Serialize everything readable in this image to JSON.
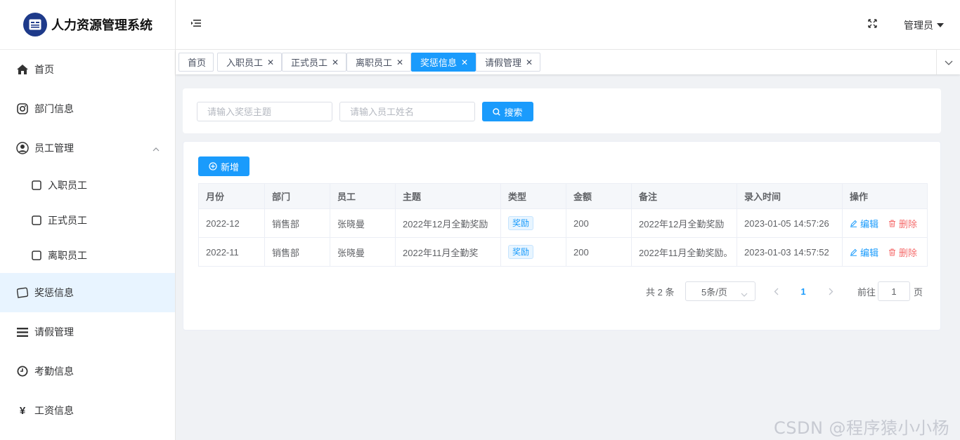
{
  "app": {
    "title": "人力资源管理系统"
  },
  "sidebar": {
    "items": [
      {
        "label": "首页",
        "icon": "home-icon"
      },
      {
        "label": "部门信息",
        "icon": "instagram-icon"
      },
      {
        "label": "员工管理",
        "icon": "user-icon",
        "expanded": true
      },
      {
        "label": "入职员工",
        "icon": "square-icon"
      },
      {
        "label": "正式员工",
        "icon": "square-icon"
      },
      {
        "label": "离职员工",
        "icon": "square-icon"
      },
      {
        "label": "奖惩信息",
        "icon": "chat-bubble-icon",
        "active": true
      },
      {
        "label": "请假管理",
        "icon": "list-icon"
      },
      {
        "label": "考勤信息",
        "icon": "clock-icon"
      },
      {
        "label": "工资信息",
        "icon": "yen-icon"
      }
    ]
  },
  "header": {
    "user": "管理员"
  },
  "tabs": [
    {
      "label": "首页",
      "closable": false
    },
    {
      "label": "入职员工",
      "closable": true
    },
    {
      "label": "正式员工",
      "closable": true
    },
    {
      "label": "离职员工",
      "closable": true
    },
    {
      "label": "奖惩信息",
      "closable": true,
      "active": true
    },
    {
      "label": "请假管理",
      "closable": true
    }
  ],
  "search": {
    "topic_placeholder": "请输入奖惩主题",
    "name_placeholder": "请输入员工姓名",
    "button": "搜索"
  },
  "toolbar": {
    "add_label": "新增"
  },
  "table": {
    "columns": [
      "月份",
      "部门",
      "员工",
      "主题",
      "类型",
      "金额",
      "备注",
      "录入时间",
      "操作"
    ],
    "rows": [
      {
        "month": "2022-12",
        "dept": "销售部",
        "employee": "张晓曼",
        "topic": "2022年12月全勤奖励",
        "type": "奖励",
        "amount": "200",
        "remark": "2022年12月全勤奖励",
        "time": "2023-01-05 14:57:26",
        "edit": "编辑",
        "delete": "删除"
      },
      {
        "month": "2022-11",
        "dept": "销售部",
        "employee": "张晓曼",
        "topic": "2022年11月全勤奖",
        "type": "奖励",
        "amount": "200",
        "remark": "2022年11月全勤奖励。",
        "time": "2023-01-03 14:57:52",
        "edit": "编辑",
        "delete": "删除"
      }
    ]
  },
  "pagination": {
    "total_text": "共 2 条",
    "page_size": "5条/页",
    "current_page": "1",
    "goto_label": "前往",
    "goto_value": "1",
    "page_suffix": "页"
  },
  "watermark": "CSDN @程序猿小小杨",
  "colors": {
    "primary": "#1a9bfc",
    "danger": "#f56c6c",
    "logo": "#1e3a8a"
  }
}
